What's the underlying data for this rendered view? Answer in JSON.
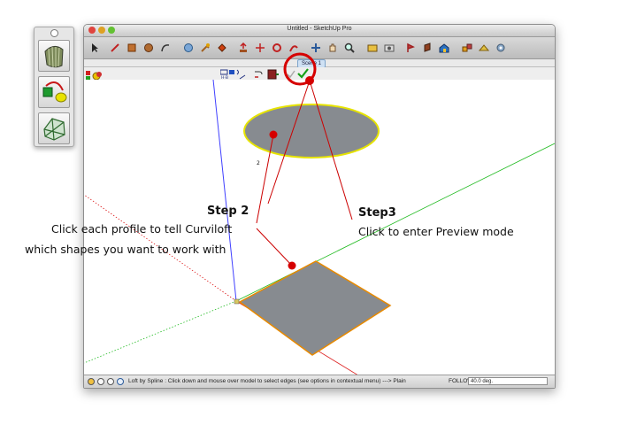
{
  "window": {
    "title": "Untitled - SketchUp Pro",
    "scene_tab": "Scene 1"
  },
  "palette": {
    "buttons": [
      "curviloft-loft-icon",
      "curviloft-skin-icon",
      "curviloft-contour-icon"
    ]
  },
  "toolbar": {
    "icons": [
      "select-icon",
      "pencil-icon",
      "rectangle-icon",
      "circle-icon",
      "arc-icon",
      "orbit-icon",
      "pan-icon",
      "paint-bucket-icon",
      "push-pull-icon",
      "move-icon",
      "rotate-icon",
      "follow-me-icon",
      "orbit-view-icon",
      "hand-icon",
      "zoom-icon",
      "zoom-extents-icon",
      "camera-icon",
      "walk-icon",
      "section-icon",
      "warehouse-icon",
      "components-icon",
      "sandbox-icon"
    ]
  },
  "statusbar": {
    "text": "Loft by Spline : Click down and mouse over model to select edges (see options in contextual menu) ---> Plain",
    "follow_label": "FOLLOW",
    "follow_value": "40.0 deg."
  },
  "annotations": {
    "step2_title": "Step 2",
    "step2_line1": "Click each profile to tell Curviloft",
    "step2_line2": "which shapes you want to work with",
    "step3_title": "Step3",
    "step3_line1": "Click to enter Preview mode"
  },
  "viewport": {
    "profile_label": "2"
  },
  "colors": {
    "accent_red": "#d60000",
    "shape_fill": "#878b90",
    "ellipse_stroke": "#e6e300",
    "square_stroke": "#e88a00",
    "axis_blue": "#3a3aff",
    "axis_green": "#22bb22",
    "axis_red": "#dd2222"
  }
}
